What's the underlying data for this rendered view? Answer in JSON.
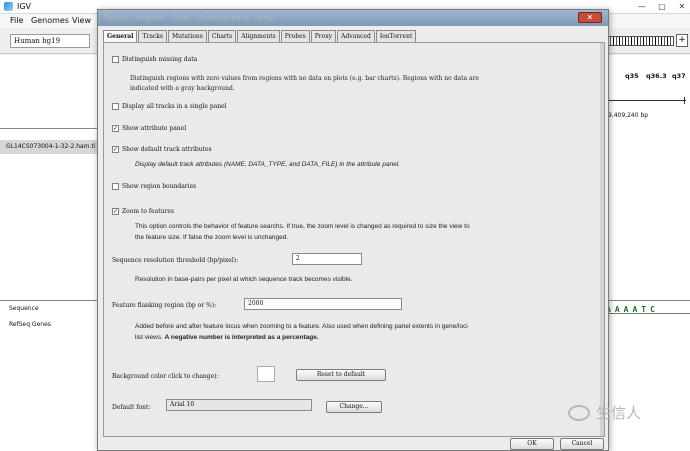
{
  "igv": {
    "title": "IGV",
    "menu": [
      "File",
      "Genomes",
      "View"
    ],
    "genome": "Human hg19",
    "band_labels": [
      "q35",
      "q36.3",
      "q37"
    ],
    "coordinate": "9,409,240 bp",
    "track_name": "GL14CS073004-1-32-2.ham.ti",
    "tracks": {
      "sequence": "Sequence",
      "refseq": "RefSeq Genes"
    },
    "sequence_bases": "AAAATC"
  },
  "dialog": {
    "menu_ghost": [
      "Tracks",
      "Regions",
      "Tools",
      "GenomeSpace",
      "Help"
    ],
    "close_label": "✕",
    "tabs": [
      "General",
      "Tracks",
      "Mutations",
      "Charts",
      "Alignments",
      "Probes",
      "Proxy",
      "Advanced",
      "IonTorrent"
    ],
    "active_tab": "General",
    "options": {
      "distinguish_missing": {
        "label": "Distinguish missing data",
        "checked": false,
        "description_line1": "Distinguish regions with zero values from regions with no data on plots (e.g. bar charts). Regions with no data are",
        "description_line2": "indicated with a gray background."
      },
      "single_panel": {
        "label": "Display all tracks in a single panel",
        "checked": false
      },
      "attribute_panel": {
        "label": "Show attribute panel",
        "checked": true
      },
      "default_attributes": {
        "label": "Show default track attributes",
        "checked": true,
        "description": "Display default track attributes (NAME, DATA_TYPE, and DATA_FILE) in the attribute panel."
      },
      "region_boundaries": {
        "label": "Show region boundaries",
        "checked": false
      },
      "zoom_to_features": {
        "label": "Zoom to features",
        "checked": true,
        "description_line1": "This option controls the behavior of feature searchs. If true, the zoom level is changed as required to size the view to",
        "description_line2": "the feature size. If false the zoom level is unchanged."
      }
    },
    "seq_threshold": {
      "label": "Sequence resolution threshold (bp/pixel):",
      "value": "2",
      "description": "Resolution in base-pairs per pixel at which sequence track becomes visible."
    },
    "flanking": {
      "label": "Feature flanking region (bp or %):",
      "value": "2000",
      "description_line1": "Added before and after feature locus when zooming to a feature. Also used when defining panel extents in gene/loci",
      "description_line2_plain": "list views. ",
      "description_line2_bold": "A negative number is interpreted as a percentage."
    },
    "background_color": {
      "label": "Background color click to change):",
      "reset_label": "Reset to default",
      "color": "#ffffff"
    },
    "default_font": {
      "label": "Default font:",
      "value": "Arial 10",
      "change_label": "Change..."
    },
    "ok_label": "OK",
    "cancel_label": "Cancel"
  },
  "watermark": "生信人",
  "colors": {
    "title_gradient_top": "#9fb7cf",
    "close_button": "#c74a3a",
    "sequence_bases": "#1f6f2c"
  }
}
